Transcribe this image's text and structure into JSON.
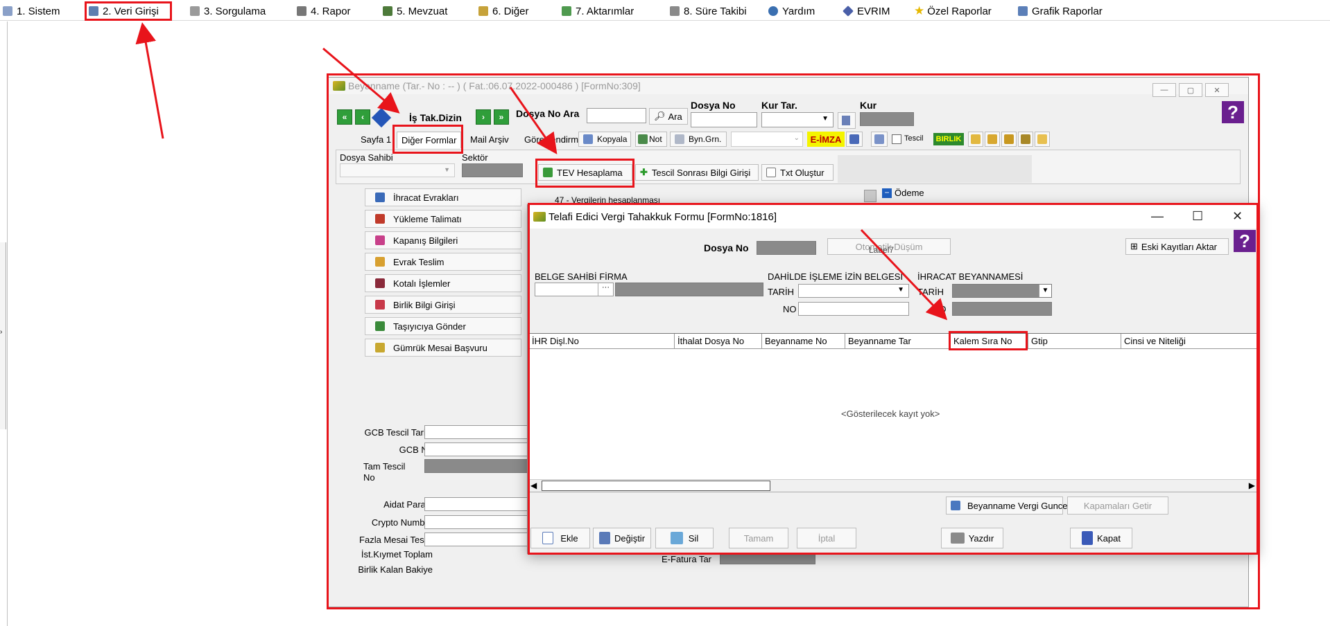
{
  "menu": [
    {
      "label": "1.  Sistem"
    },
    {
      "label": "2.  Veri Girişi"
    },
    {
      "label": "3.  Sorgulama"
    },
    {
      "label": "4.  Rapor"
    },
    {
      "label": "5.  Mevzuat"
    },
    {
      "label": "6.  Diğer"
    },
    {
      "label": "7.  Aktarımlar"
    },
    {
      "label": "8. Süre Takibi"
    },
    {
      "label": "Yardım"
    },
    {
      "label": "EVRIM"
    },
    {
      "label": "Özel Raporlar"
    },
    {
      "label": "Grafik Raporlar"
    }
  ],
  "main": {
    "title": "Beyanname (Tar.- No :  --  ) ( Fat.:06.07.2022-000486 )  [FormNo:309]",
    "is_tak_dizin": "İş Tak.Dizin",
    "dosya_no_ara": "Dosya No Ara",
    "ara_button": "Ara",
    "dosya_no_label": "Dosya No",
    "kur_tar_label": "Kur Tar.",
    "kur_label": "Kur",
    "tabs": [
      "Sayfa 1",
      "Diğer Formlar",
      "Mail Arşiv",
      "Görevlendirme"
    ],
    "toolbar": {
      "kopyala": "Kopyala",
      "not": "Not",
      "byn_grn": "Byn.Grn.",
      "e_imza": "E-İMZA",
      "tescil": "Tescil",
      "birlik": "BIRLIK"
    },
    "dosya_sahibi": "Dosya Sahibi",
    "sektor": "Sektör",
    "tev_hesaplama": "TEV Hesaplama",
    "tescil_sonrasi": "Tescil Sonrası Bilgi Girişi",
    "txt_olustur": "Txt Oluştur",
    "vergi_label": "47 - Vergilerin hesaplanması",
    "odeme": "Ödeme",
    "side_buttons": [
      "İhracat Evrakları",
      "Yükleme Talimatı",
      "Kapanış Bilgileri",
      "Evrak Teslim",
      "Kotalı İşlemler",
      "Birlik Bilgi Girişi",
      "Taşıyıcıya Gönder",
      "Gümrük Mesai Başvuru"
    ],
    "fields": {
      "gcb_tescil_tarihi": "GCB Tescil Tarihi",
      "gcb_no": "GCB No",
      "tam_tescil_no": "Tam Tescil\nNo",
      "aidat_parasi": "Aidat Parası",
      "crypto_number": "Crypto Number",
      "fazla_mesai_tescil": "Fazla Mesai Tescil",
      "ist_kiymet_toplam": "İst.Kıymet Toplam",
      "birlik_kalan_bakiye": "Birlik Kalan Bakiye",
      "e_fatura_tar": "E-Fatura Tar"
    }
  },
  "popup": {
    "title": "Telafi Edici Vergi Tahakkuk Formu [FormNo:1816]",
    "dosya_no": "Dosya No",
    "otomatik_dusum": "Otomatik Düşüm",
    "label_ghost": "Label7",
    "eski_kayitlari_aktar": "Eski Kayıtları Aktar",
    "belge_sahibi_firma": "BELGE SAHİBİ FİRMA",
    "dahilde_isleme": "DAHİLDE İŞLEME İZİN BELGESİ",
    "ihracat_beyannamesi": "İHRACAT BEYANNAMESİ",
    "tarih": "TARİH",
    "no": "NO",
    "ellipsis": "···",
    "columns": [
      "İHR Dişl.No",
      "İthalat Dosya No",
      "Beyanname No",
      "Beyanname Tar",
      "Kalem Sıra No",
      "Gtip",
      "Cinsi ve Niteliği"
    ],
    "empty_text": "<Gösterilecek kayıt yok>",
    "beyanname_vergi_guncelle": "Beyanname Vergi Guncelle",
    "kapamalari_getir": "Kapamaları Getir",
    "buttons": {
      "ekle": "Ekle",
      "degistir": "Değiştir",
      "sil": "Sil",
      "tamam": "Tamam",
      "iptal": "İptal",
      "yazdir": "Yazdır",
      "kapat": "Kapat"
    }
  },
  "colors": {
    "highlight": "#e8141b",
    "grey_field": "#8a8a8a",
    "help_purple": "#6a1f8f",
    "eimza_yellow": "#f4f400",
    "nav_green": "#2f9e3a"
  },
  "icons": {
    "help": "?"
  }
}
